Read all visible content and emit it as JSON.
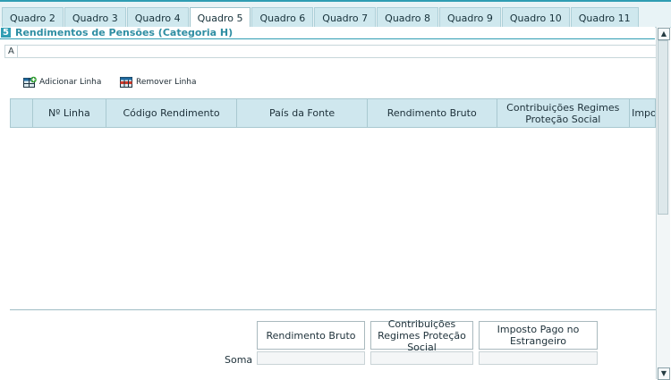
{
  "tabs": [
    {
      "label": "Quadro 2"
    },
    {
      "label": "Quadro 3"
    },
    {
      "label": "Quadro 4"
    },
    {
      "label": "Quadro 5"
    },
    {
      "label": "Quadro 6"
    },
    {
      "label": "Quadro 7"
    },
    {
      "label": "Quadro 8"
    },
    {
      "label": "Quadro 9"
    },
    {
      "label": "Quadro 10"
    },
    {
      "label": "Quadro 11"
    }
  ],
  "active_tab": "Quadro 5",
  "section": {
    "number": "5",
    "title": "Rendimentos de Pensões (Categoria H)"
  },
  "subsection": {
    "label": "A"
  },
  "toolbar": {
    "add_label": "Adicionar Linha",
    "remove_label": "Remover Linha"
  },
  "table": {
    "columns": [
      "Nº Linha",
      "Código Rendimento",
      "País da Fonte",
      "Rendimento Bruto",
      "Contribuições Regimes Proteção Social",
      "Impo"
    ],
    "rows": []
  },
  "totals": {
    "row_label": "Soma",
    "headers": [
      "Rendimento Bruto",
      "Contribuições Regimes Proteção Social",
      "Imposto Pago no Estrangeiro"
    ]
  },
  "colors": {
    "accent": "#2f9db3",
    "header_bg": "#cfe7ee",
    "tab_bg": "#cfe8ee"
  },
  "icons": {
    "add": "add-row-icon",
    "remove": "remove-row-icon",
    "scroll_up": "arrow-up-icon",
    "scroll_down": "arrow-down-icon"
  }
}
